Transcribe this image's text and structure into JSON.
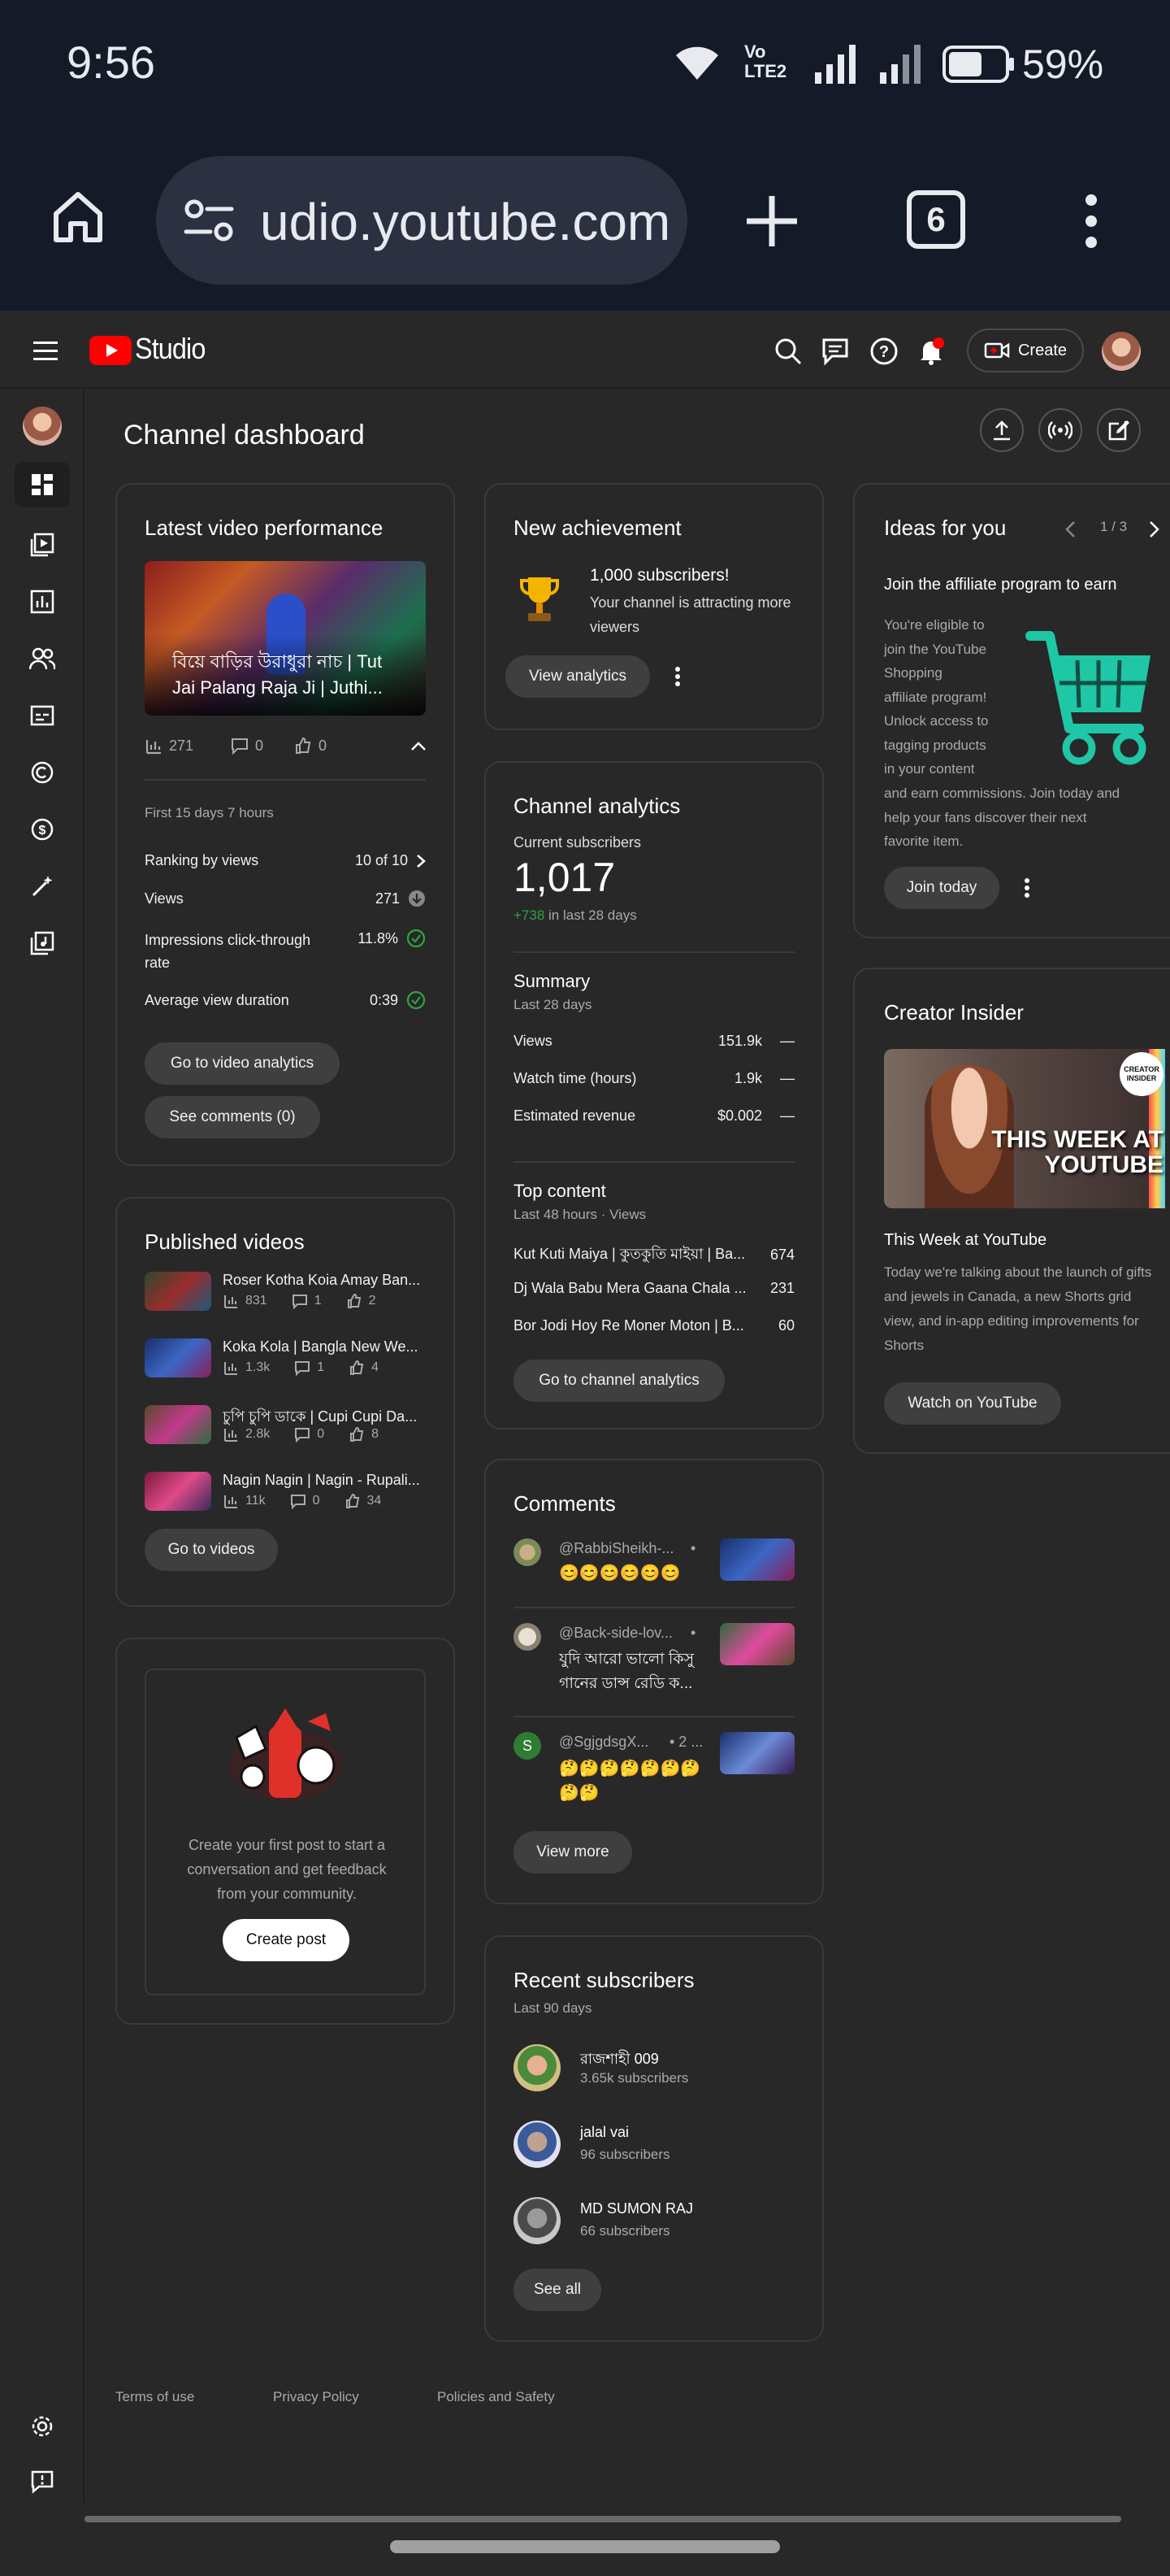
{
  "status_bar": {
    "time": "9:56",
    "network": "Vo LTE2",
    "battery": "59%"
  },
  "browser": {
    "url": "udio.youtube.com",
    "tab_count": "6"
  },
  "studio_header": {
    "logo_text": "Studio",
    "create_label": "Create"
  },
  "page_title": "Channel dashboard",
  "latest_video": {
    "heading": "Latest video performance",
    "video_title": "বিয়ে বাড়ির উরাধুরা নাচ | Tut Jai Palang Raja Ji | Juthi...",
    "views_count": "271",
    "comments_count": "0",
    "likes_count": "0",
    "period": "First 15 days 7 hours",
    "metrics": [
      {
        "label": "Ranking by views",
        "value": "10 of 10"
      },
      {
        "label": "Views",
        "value": "271"
      },
      {
        "label": "Impressions click-through rate",
        "value": "11.8%"
      },
      {
        "label": "Average view duration",
        "value": "0:39"
      }
    ],
    "analytics_button": "Go to video analytics",
    "comments_button": "See comments (0)"
  },
  "published_videos": {
    "heading": "Published videos",
    "items": [
      {
        "title": "Roser Kotha Koia Amay Ban...",
        "views": "831",
        "comments": "1",
        "likes": "2"
      },
      {
        "title": "Koka Kola | Bangla New We...",
        "views": "1.3k",
        "comments": "1",
        "likes": "4"
      },
      {
        "title": "চুপি চুপি ডাকে | Cupi Cupi Da...",
        "views": "2.8k",
        "comments": "0",
        "likes": "8"
      },
      {
        "title": "Nagin Nagin | Nagin - Rupali...",
        "views": "11k",
        "comments": "0",
        "likes": "34"
      }
    ],
    "button": "Go to videos"
  },
  "post_card": {
    "text": "Create your first post to start a conversation and get feedback from your community.",
    "button": "Create post"
  },
  "achievement": {
    "heading": "New achievement",
    "title": "1,000 subscribers!",
    "text": "Your channel is attracting more viewers",
    "button": "View analytics"
  },
  "channel_analytics": {
    "heading": "Channel analytics",
    "subs_label": "Current subscribers",
    "subs_value": "1,017",
    "subs_delta": "+738",
    "subs_delta_suffix": " in last 28 days",
    "summary_heading": "Summary",
    "summary_period": "Last 28 days",
    "summary": [
      {
        "label": "Views",
        "value": "151.9k",
        "trend": "—"
      },
      {
        "label": "Watch time (hours)",
        "value": "1.9k",
        "trend": "—"
      },
      {
        "label": "Estimated revenue",
        "value": "$0.002",
        "trend": "—"
      }
    ],
    "top_heading": "Top content",
    "top_period": "Last 48 hours · Views",
    "top": [
      {
        "title": "Kut Kuti Maiya | কুতকুতি মাইয়া | Ba...",
        "value": "674"
      },
      {
        "title": "Dj Wala Babu Mera Gaana Chala ...",
        "value": "231"
      },
      {
        "title": "Bor Jodi Hoy Re Moner Moton | B...",
        "value": "60"
      }
    ],
    "button": "Go to channel analytics"
  },
  "comments": {
    "heading": "Comments",
    "items": [
      {
        "author": "@RabbiSheikh-...",
        "meta": "•",
        "text": "😊😊😊😊😊😊",
        "avatar_letter": ""
      },
      {
        "author": "@Back-side-lov...",
        "meta": "•",
        "text": "যুদি আরো ভালো কিসু গানের ডান্স রেডি ক...",
        "avatar_letter": ""
      },
      {
        "author": "@SgjgdsgX...",
        "meta": "• 2 ...",
        "text": "🤔🤔🤔🤔🤔🤔🤔🤔🤔",
        "avatar_letter": "S"
      }
    ],
    "button": "View more"
  },
  "recent_subscribers": {
    "heading": "Recent subscribers",
    "period": "Last 90 days",
    "items": [
      {
        "name": "রাজশাহী 009",
        "count": "3.65k subscribers"
      },
      {
        "name": "jalal vai",
        "count": "96 subscribers"
      },
      {
        "name": "MD SUMON RAJ",
        "count": "66 subscribers"
      }
    ],
    "button": "See all"
  },
  "ideas": {
    "heading": "Ideas for you",
    "pager": "1 / 3",
    "title": "Join the affiliate program to earn",
    "body_narrow": [
      "You're eligible to",
      "join the YouTube",
      "Shopping",
      "affiliate program!",
      "Unlock access to",
      "tagging products",
      "in your content"
    ],
    "body_wide": [
      "and earn commissions. Join today and",
      "help your fans discover their next",
      "favorite item."
    ],
    "button": "Join today"
  },
  "creator_insider": {
    "heading": "Creator Insider",
    "thumb_text": "THIS WEEK AT YOUTUBE",
    "badge_text": "CREATOR INSIDER",
    "video_title": "This Week at YouTube",
    "description": "Today we're talking about the launch of gifts and jewels in Canada, a new Shorts grid view, and in-app editing improvements for Shorts",
    "button": "Watch on YouTube"
  },
  "footer": {
    "links": [
      "Terms of use",
      "Privacy Policy",
      "Policies and Safety"
    ]
  },
  "colors": {
    "accent_green": "#2ba640",
    "youtube_red": "#ff0000",
    "cart_teal": "#1fc7a6"
  }
}
